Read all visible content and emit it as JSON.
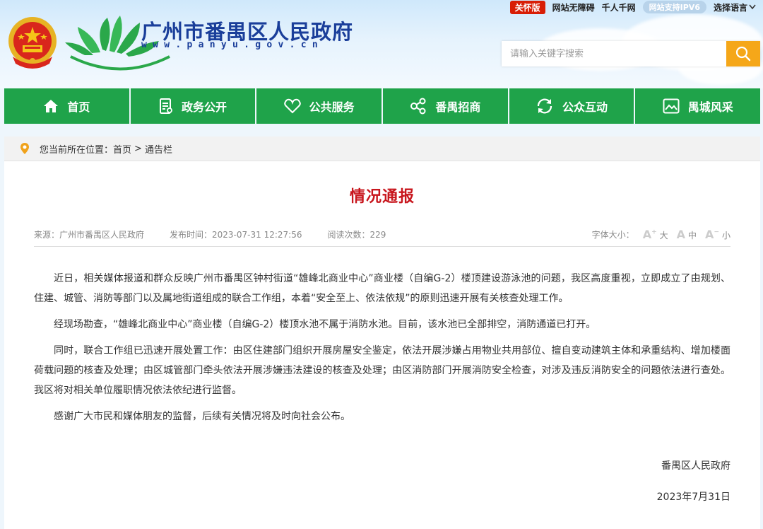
{
  "topbar": {
    "care_label": "关怀版",
    "accessibility_label": "网站无障碍",
    "thousand_label": "千人千网",
    "ipv6_label": "网站支持IPV6",
    "language_label": "选择语言"
  },
  "header": {
    "title": "广州市番禺区人民政府",
    "url": "www.panyu.gov.cn",
    "search_placeholder": "请输入关键字搜索"
  },
  "nav": {
    "items": [
      {
        "label": "首页",
        "icon": "home-icon"
      },
      {
        "label": "政务公开",
        "icon": "document-icon"
      },
      {
        "label": "公共服务",
        "icon": "heart-icon"
      },
      {
        "label": "番禺招商",
        "icon": "share-icon"
      },
      {
        "label": "公众互动",
        "icon": "refresh-icon"
      },
      {
        "label": "禺城风采",
        "icon": "picture-icon"
      }
    ],
    "color": "#1fa34a"
  },
  "breadcrumb": {
    "prefix": "您当前所在位置：",
    "home": "首页",
    "separator": ">",
    "current": "通告栏"
  },
  "article": {
    "title": "情况通报",
    "source": "来源：广州市番禺区人民政府",
    "publish_time": "发布时间：2023-07-31 12:27:56",
    "read_count": "阅读次数：229",
    "fontsize_label": "字体大小：",
    "font_large": "大",
    "font_medium": "中",
    "font_small": "小",
    "paragraphs": [
      "近日，相关媒体报道和群众反映广州市番禺区钟村街道“雄峰北商业中心”商业楼（自编G-2）楼顶建设游泳池的问题，我区高度重视，立即成立了由规划、住建、城管、消防等部门以及属地街道组成的联合工作组，本着“安全至上、依法依规”的原则迅速开展有关核查处理工作。",
      "经现场勘查，“雄峰北商业中心”商业楼（自编G-2）楼顶水池不属于消防水池。目前，该水池已全部排空，消防通道已打开。",
      "同时，联合工作组已迅速开展处置工作：由区住建部门组织开展房屋安全鉴定，依法开展涉嫌占用物业共用部位、擅自变动建筑主体和承重结构、增加楼面荷载问题的核查及处理；由区城管部门牵头依法开展涉嫌违法建设的核查及处理；由区消防部门开展消防安全检查，对涉及违反消防安全的问题依法进行查处。我区将对相关单位履职情况依法依纪进行监督。",
      "感谢广大市民和媒体朋友的监督，后续有关情况将及时向社会公布。"
    ],
    "signature": "番禺区人民政府",
    "date": "2023年7月31日",
    "title_color": "#c8161d"
  }
}
